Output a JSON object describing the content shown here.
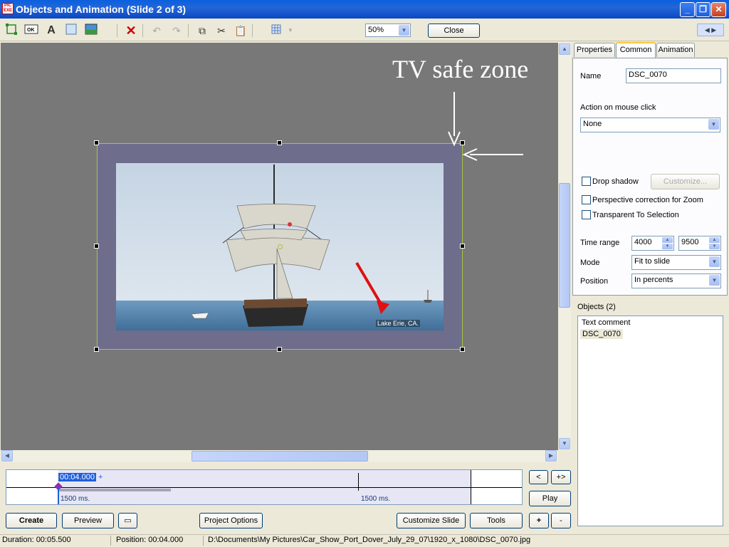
{
  "window": {
    "title": "Objects and Animation  (Slide 2 of 3)",
    "app_icon_text": "PIC EXE"
  },
  "toolbar": {
    "zoom": "50%",
    "close_label": "Close"
  },
  "canvas": {
    "annotation": "TV safe zone",
    "photo_caption": "Lake Erie, CA."
  },
  "tabs": [
    {
      "label": "Properties"
    },
    {
      "label": "Common"
    },
    {
      "label": "Animation"
    }
  ],
  "properties": {
    "name_label": "Name",
    "name_value": "DSC_0070",
    "action_label": "Action on mouse click",
    "action_value": "None",
    "drop_shadow_label": "Drop shadow",
    "customize_label": "Customize...",
    "perspective_label": "Perspective correction for Zoom",
    "transparent_label": "Transparent To Selection",
    "time_range_label": "Time range",
    "time_start": "4000",
    "time_end": "9500",
    "mode_label": "Mode",
    "mode_value": "Fit to slide",
    "position_label": "Position",
    "position_value": "In percents"
  },
  "objects": {
    "header": "Objects (2)",
    "items": [
      {
        "label": "Text comment"
      },
      {
        "label": "DSC_0070"
      }
    ]
  },
  "timeline": {
    "current_time": "00:04.000",
    "plus": "+",
    "marker1": "1500 ms.",
    "marker2": "1500 ms."
  },
  "nav": {
    "prev": "<",
    "next": "+>",
    "play": "Play",
    "add": "+",
    "remove": "-"
  },
  "bottom": {
    "create": "Create",
    "preview": "Preview",
    "project_options": "Project Options",
    "customize_slide": "Customize Slide",
    "tools": "Tools"
  },
  "status": {
    "duration": "Duration:  00:05.500",
    "position": "Position:  00:04.000",
    "path": "D:\\Documents\\My Pictures\\Car_Show_Port_Dover_July_29_07\\1920_x_1080\\DSC_0070.jpg"
  },
  "colors": {
    "title_bar": "#0b48c4",
    "canvas": "#787878",
    "safe_zone": "#6e6d8b",
    "selection_frame": "#a4c73b",
    "annotation_arrow_red": "#e01010"
  }
}
